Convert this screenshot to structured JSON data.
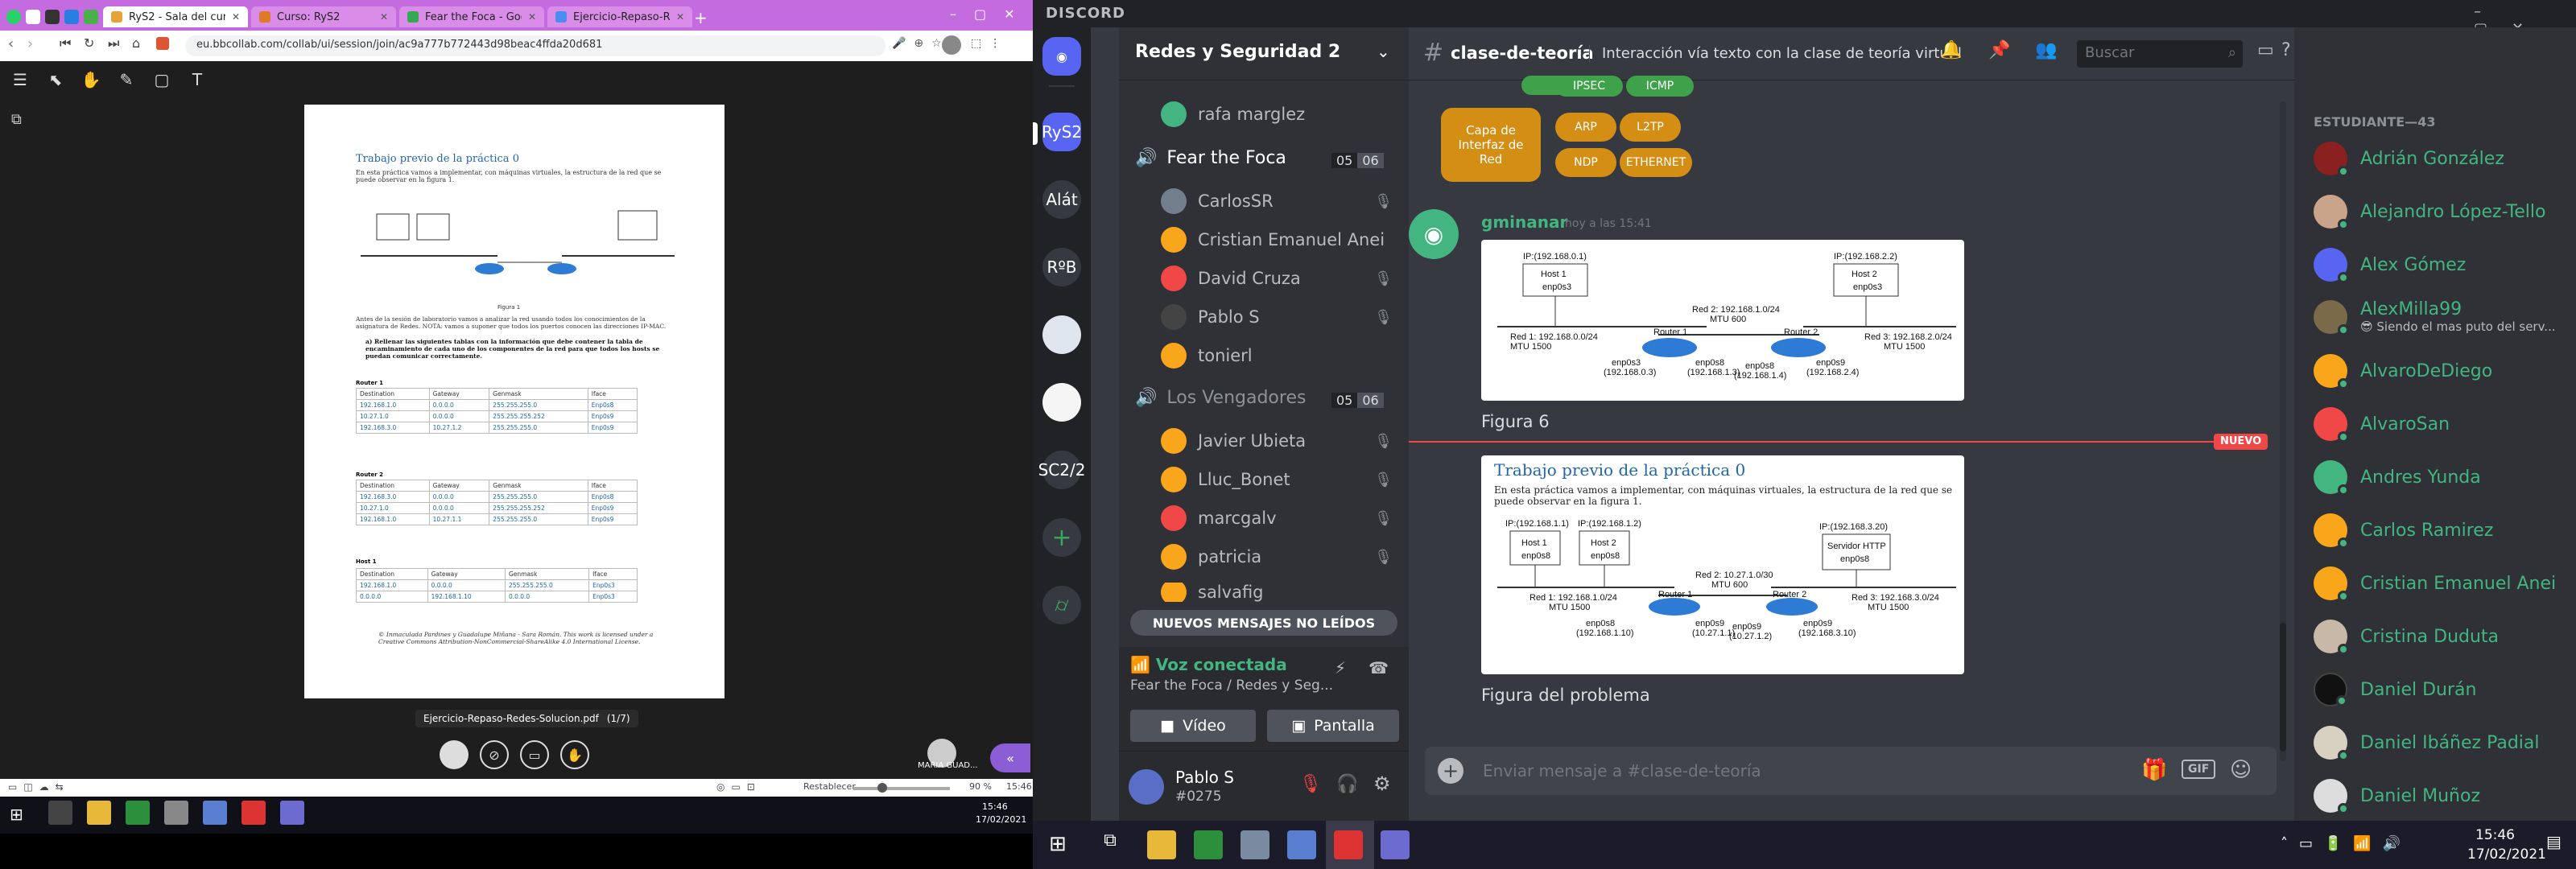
{
  "browser": {
    "tabs": [
      {
        "label": "RyS2 - Sala del curso - Bb"
      },
      {
        "label": "Curso: RyS2"
      },
      {
        "label": "Fear the Foca - Google Dr"
      },
      {
        "label": "Ejercicio-Repaso-Redes - D"
      }
    ],
    "url": "eu.bbcollab.com/collab/ui/session/join/ac9a777b772443d98beac4ffda20d681"
  },
  "pdf": {
    "heading": "Trabajo previo de la práctica 0",
    "intro": "En esta práctica vamos a implementar, con máquinas virtuales, la estructura de la red que se puede observar en la figura 1.",
    "figure_caption": "Figura 1",
    "para": "Antes de la sesión de laboratorio vamos a analizar la red usando todos los conocimientos de la asignatura de Redes. NOTA: vamos a suponer que todos los puertos conocen las direcciones IP-MAC.",
    "task": "a) Rellenar las siguientes tablas con la información que debe contener la tabla de encaminamiento de cada uno de los componentes de la red para que todos los hosts se puedan comunicar correctamente.",
    "headers": [
      "Destination",
      "Gateway",
      "Genmask",
      "Iface"
    ],
    "router1": {
      "title": "Router 1",
      "rows": [
        [
          "192.168.1.0",
          "0.0.0.0",
          "255.255.255.0",
          "Enp0s8"
        ],
        [
          "10.27.1.0",
          "0.0.0.0",
          "255.255.255.252",
          "Enp0s9"
        ],
        [
          "192.168.3.0",
          "10.27.1.2",
          "255.255.255.0",
          "Enp0s9"
        ]
      ]
    },
    "router2": {
      "title": "Router 2",
      "rows": [
        [
          "192.168.3.0",
          "0.0.0.0",
          "255.255.255.0",
          "Enp0s8"
        ],
        [
          "10.27.1.0",
          "0.0.0.0",
          "255.255.255.252",
          "Enp0s9"
        ],
        [
          "192.168.1.0",
          "10.27.1.1",
          "255.255.255.0",
          "Enp0s9"
        ]
      ]
    },
    "host1": {
      "title": "Host 1",
      "rows": [
        [
          "192.168.1.0",
          "0.0.0.0",
          "255.255.255.0",
          "Enp0s3"
        ],
        [
          "0.0.0.0",
          "192.168.1.10",
          "0.0.0.0",
          "Enp0s3"
        ]
      ]
    },
    "license": "© Inmaculada Pardines y Guadalupe Miñana - Sara Román. This work is licensed under a Creative Commons Attribution-NonCommercial-ShareAlike 4.0 International License.",
    "filename": "Ejercicio-Repaso-Redes-Solucion.pdf",
    "pages": "(1/7)",
    "zoom": "90 %",
    "restore": "Restablecer",
    "user_name": "MARIA GUAD..."
  },
  "win_left": {
    "time": "15:46",
    "date": "17/02/2021"
  },
  "discord": {
    "brand": "DISCORD",
    "server": "Redes y Seguridad 2",
    "guilds": [
      {
        "label": "RyS2"
      },
      {
        "label": "Alát"
      },
      {
        "label": "RºB"
      },
      {
        "label": "SC2/2"
      }
    ],
    "top_user": "rafa marglez",
    "channel1": {
      "name": "Fear the Foca",
      "count": "05",
      "limit": "06",
      "users": [
        "CarlosSR",
        "Cristian Emanuel Anei",
        "David Cruza",
        "Pablo S",
        "tonierl"
      ]
    },
    "channel2": {
      "name": "Los Vengadores",
      "count": "05",
      "limit": "06",
      "users": [
        "Javier Ubieta",
        "Lluc_Bonet",
        "marcgalv",
        "patricia",
        "salvafig"
      ]
    },
    "new_messages": "NUEVOS MENSAJES NO LEÍDOS",
    "voice": {
      "status": "Voz conectada",
      "where": "Fear the Foca / Redes y Seg...",
      "video": "Vídeo",
      "screen": "Pantalla"
    },
    "me": {
      "name": "Pablo S",
      "tag": "#0275"
    },
    "channel": "clase-de-teoría",
    "topic": "Interacción vía texto con la clase de teoría virtual",
    "search": "Buscar",
    "tags_top": [
      "IPSEC",
      "ICMP"
    ],
    "layer_tag": "Capa de Interfaz de Red",
    "tags": [
      "ARP",
      "L2TP",
      "NDP",
      "ETHERNET"
    ],
    "message": {
      "author": "gminanar",
      "time": "hoy a las 15:41",
      "fig6": "Figura 6",
      "fig_prob": "Figura del problema"
    },
    "new_badge": "NUEVO",
    "embed_heading": "Trabajo previo de la práctica 0",
    "embed_text": "En esta práctica vamos a implementar, con máquinas virtuales, la estructura de la red que se puede observar en la figura 1.",
    "input_placeholder": "Enviar mensaje a #clase-de-teoría",
    "gif": "GIF",
    "members_header": "ESTUDIANTE—43",
    "members": [
      {
        "name": "Adrián González"
      },
      {
        "name": "Alejandro López-Tello"
      },
      {
        "name": "Alex Gómez"
      },
      {
        "name": "AlexMilla99",
        "status": "😎 Siendo el mas puto del serv..."
      },
      {
        "name": "AlvaroDeDiego"
      },
      {
        "name": "AlvaroSan"
      },
      {
        "name": "Andres Yunda"
      },
      {
        "name": "Carlos Ramirez"
      },
      {
        "name": "Cristian Emanuel Anei"
      },
      {
        "name": "Cristina Duduta"
      },
      {
        "name": "Daniel Durán"
      },
      {
        "name": "Daniel Ibáñez Padial"
      },
      {
        "name": "Daniel Muñoz"
      }
    ],
    "win_time": "15:46",
    "win_date": "17/02/2021"
  },
  "net": {
    "fig6": {
      "h1": "IP:(192.168.0.1)",
      "h1n": "Host 1",
      "h1e": "enp0s3",
      "h2": "IP:(192.168.2.2)",
      "h2n": "Host 2",
      "h2e": "enp0s3",
      "red1": "Red 1: 192.168.0.0/24",
      "mtu1": "MTU 1500",
      "red2": "Red 2: 192.168.1.0/24",
      "mtu2": "MTU 600",
      "red3": "Red 3: 192.168.2.0/24",
      "mtu3": "MTU 1500",
      "r1": "Router 1",
      "r2": "Router 2",
      "e1": "enp0s3",
      "e1ip": "(192.168.0.3)",
      "e2": "enp0s8",
      "e2ip": "(192.168.1.3)",
      "e3": "enp0s8",
      "e3ip": "(192.168.1.4)",
      "e4": "enp0s9",
      "e4ip": "(192.168.2.4)"
    },
    "fig": {
      "h1": "IP:(192.168.1.1)",
      "h1n": "Host 1",
      "h1e": "enp0s8",
      "h2": "IP:(192.168.1.2)",
      "h2n": "Host 2",
      "h2e": "enp0s8",
      "srv": "IP:(192.168.3.20)",
      "srvn": "Servidor HTTP",
      "srve": "enp0s8",
      "red1": "Red 1: 192.168.1.0/24",
      "mtu1": "MTU 1500",
      "red2": "Red 2: 10.27.1.0/30",
      "mtu2": "MTU 600",
      "red3": "Red 3: 192.168.3.0/24",
      "mtu3": "MTU 1500",
      "r1": "Router 1",
      "r2": "Router 2",
      "e1": "enp0s8",
      "e1ip": "(192.168.1.10)",
      "e2": "enp0s9",
      "e2ip": "(10.27.1.1)",
      "e3": "enp0s9",
      "e3ip": "(10.27.1.2)",
      "e4": "enp0s9",
      "e4ip": "(192.168.3.10)"
    }
  }
}
